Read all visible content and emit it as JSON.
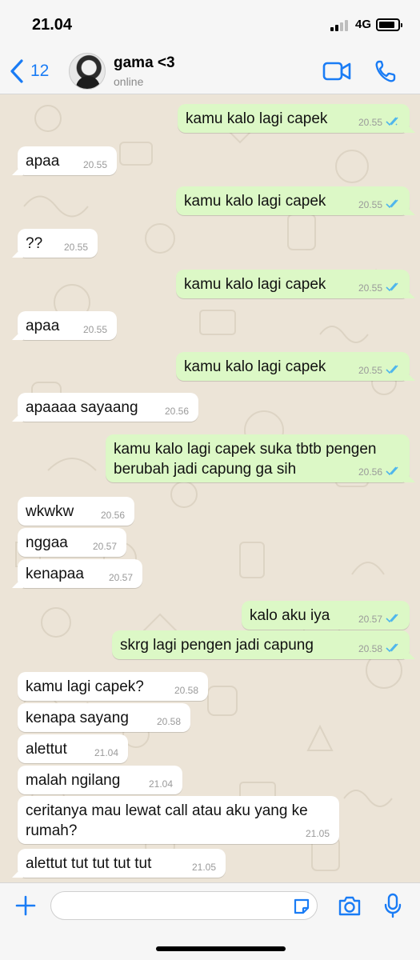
{
  "status_bar": {
    "time": "21.04",
    "network": "4G"
  },
  "header": {
    "back_count": "12",
    "contact_name": "gama <3",
    "contact_status": "online"
  },
  "messages": [
    {
      "dir": "out",
      "text": "kamu kalo lagi capek",
      "time": "20.55",
      "read": true
    },
    {
      "dir": "in",
      "text": "apaa",
      "time": "20.55"
    },
    {
      "dir": "out",
      "text": "kamu kalo lagi capek",
      "time": "20.55",
      "read": true
    },
    {
      "dir": "in",
      "text": "??",
      "time": "20.55"
    },
    {
      "dir": "out",
      "text": "kamu kalo lagi capek",
      "time": "20.55",
      "read": true
    },
    {
      "dir": "in",
      "text": "apaa",
      "time": "20.55"
    },
    {
      "dir": "out",
      "text": "kamu kalo lagi capek",
      "time": "20.55",
      "read": true
    },
    {
      "dir": "in",
      "text": "apaaaa sayaang",
      "time": "20.56"
    },
    {
      "dir": "out",
      "text_line1": "kamu kalo lagi capek suka tbtb pengen",
      "text_line2": "berubah jadi capung ga sih",
      "time": "20.56",
      "read": true
    },
    {
      "dir": "in",
      "text": "wkwkw",
      "time": "20.56"
    },
    {
      "dir": "in",
      "text": "nggaa",
      "time": "20.57"
    },
    {
      "dir": "in",
      "text": "kenapaa",
      "time": "20.57"
    },
    {
      "dir": "out",
      "text": "kalo aku iya",
      "time": "20.57",
      "read": true
    },
    {
      "dir": "out",
      "text": "skrg lagi pengen jadi capung",
      "time": "20.58",
      "read": true
    },
    {
      "dir": "in",
      "text": "kamu lagi capek?",
      "time": "20.58"
    },
    {
      "dir": "in",
      "text": "kenapa sayang",
      "time": "20.58"
    },
    {
      "dir": "in",
      "text": "alettut",
      "time": "21.04"
    },
    {
      "dir": "in",
      "text": "malah ngilang",
      "time": "21.04"
    },
    {
      "dir": "in",
      "text_line1": "ceritanya mau lewat call atau aku yang ke",
      "text_line2": "rumah?",
      "time": "21.05"
    },
    {
      "dir": "in",
      "text": "alettut tut tut tut tut",
      "time": "21.05"
    }
  ],
  "composer": {
    "value": "",
    "placeholder": ""
  },
  "colors": {
    "accent": "#1a7cf5",
    "outgoing_bubble": "#dcf8c6",
    "incoming_bubble": "#ffffff",
    "read_ticks": "#4fb6ec",
    "chat_background": "#ece4d7"
  },
  "icons": [
    "chevron-left-icon",
    "video-camera-icon",
    "phone-icon",
    "plus-icon",
    "sticker-icon",
    "camera-icon",
    "microphone-icon",
    "double-check-icon"
  ]
}
